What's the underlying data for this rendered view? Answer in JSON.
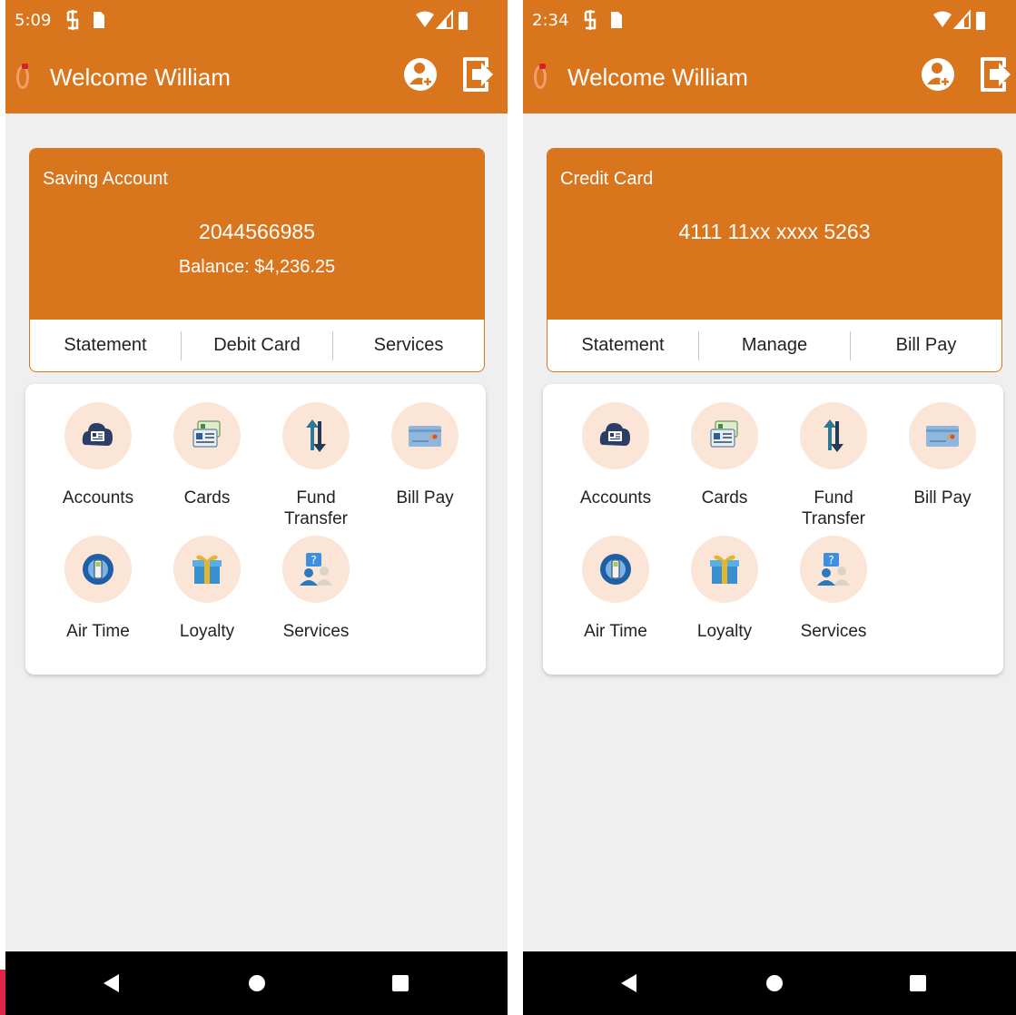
{
  "screens": [
    {
      "status_time": "5:09",
      "welcome": "Welcome William",
      "card": {
        "type": "Saving Account",
        "number": "2044566985",
        "balance": "Balance: $4,236.25",
        "actions": [
          "Statement",
          "Debit Card",
          "Services"
        ]
      }
    },
    {
      "status_time": "2:34",
      "welcome": "Welcome William",
      "card": {
        "type": "Credit Card",
        "number": "4111 11xx xxxx 5263",
        "balance": "",
        "actions": [
          "Statement",
          "Manage",
          "Bill Pay"
        ]
      }
    }
  ],
  "menu": [
    {
      "label": "Accounts",
      "icon": "accounts-icon"
    },
    {
      "label": "Cards",
      "icon": "cards-icon"
    },
    {
      "label": "Fund Transfer",
      "icon": "fund-transfer-icon"
    },
    {
      "label": "Bill Pay",
      "icon": "bill-pay-icon"
    },
    {
      "label": "Air Time",
      "icon": "air-time-icon"
    },
    {
      "label": "Loyalty",
      "icon": "loyalty-icon"
    },
    {
      "label": "Services",
      "icon": "services-icon"
    }
  ],
  "colors": {
    "brand": "#d9751c",
    "icon_bg": "#fbe5d7",
    "background": "#efefef",
    "nav_bar": "#000000"
  }
}
